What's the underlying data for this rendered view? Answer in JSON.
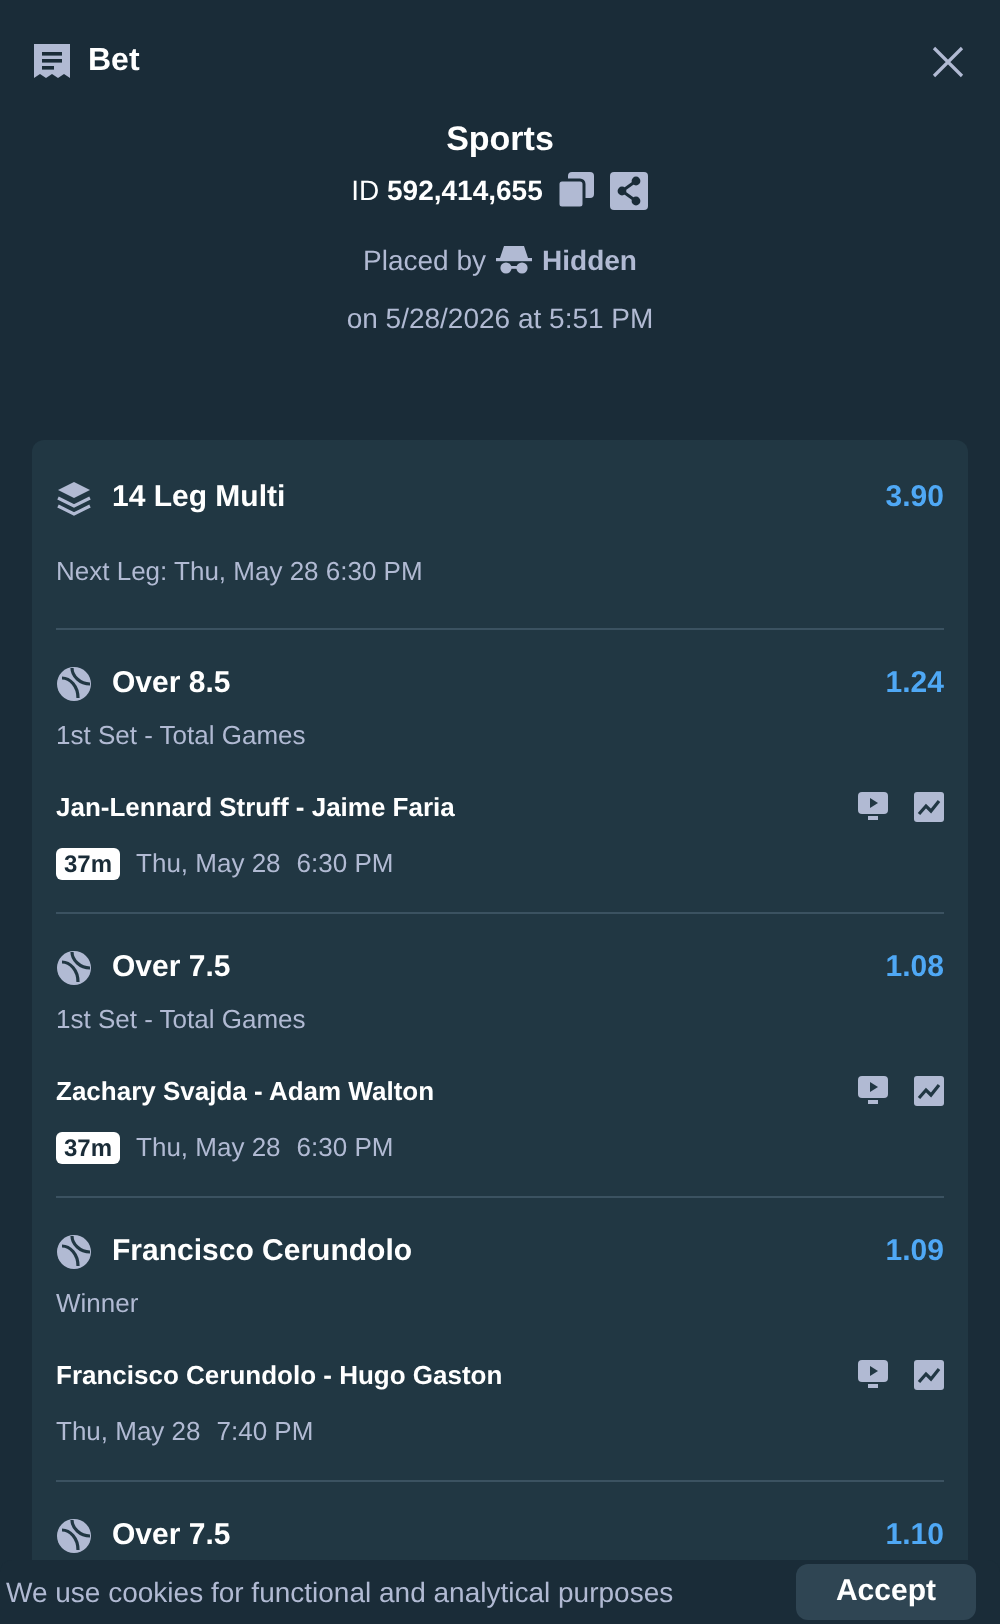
{
  "header": {
    "title": "Bet"
  },
  "summary": {
    "category": "Sports",
    "id_label": "ID",
    "id_value": "592,414,655",
    "placed_by": "Placed by",
    "user": "Hidden",
    "placed_on": "on 5/28/2026 at 5:51 PM"
  },
  "multi": {
    "title": "14 Leg Multi",
    "odds": "3.90",
    "next_leg": "Next Leg: Thu, May 28 6:30 PM"
  },
  "legs": [
    {
      "selection": "Over 8.5",
      "odds": "1.24",
      "market": "1st Set - Total Games",
      "match": "Jan-Lennard Struff - Jaime Faria",
      "live_badge": "37m",
      "date": "Thu, May 28",
      "time": "6:30 PM"
    },
    {
      "selection": "Over 7.5",
      "odds": "1.08",
      "market": "1st Set - Total Games",
      "match": "Zachary Svajda - Adam Walton",
      "live_badge": "37m",
      "date": "Thu, May 28",
      "time": "6:30 PM"
    },
    {
      "selection": "Francisco Cerundolo",
      "odds": "1.09",
      "market": "Winner",
      "match": "Francisco Cerundolo - Hugo Gaston",
      "date": "Thu, May 28",
      "time": "7:40 PM"
    },
    {
      "selection": "Over 7.5",
      "odds": "1.10"
    }
  ],
  "cookie_banner": {
    "message": "We use cookies for functional and analytical purposes",
    "accept": "Accept"
  }
}
